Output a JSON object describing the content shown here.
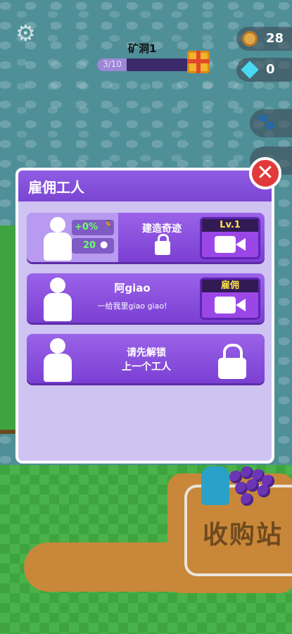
{
  "hud": {
    "mine_label": "矿洞1",
    "progress_text": "3/10",
    "progress_fraction": 0.3,
    "coins": "28",
    "gems": "0"
  },
  "dialog": {
    "title": "雇佣工人",
    "close_label": "✕",
    "workers": [
      {
        "speed_bonus": "+0%",
        "capacity": "20",
        "center_title": "建造奇迹",
        "button_tag": "Lv.1"
      },
      {
        "name": "阿giao",
        "description": "一给我里giao giao!",
        "button_tag": "雇佣"
      },
      {
        "locked_line1": "请先解锁",
        "locked_line2": "上一个工人"
      }
    ]
  },
  "world": {
    "station_label": "收购站"
  }
}
